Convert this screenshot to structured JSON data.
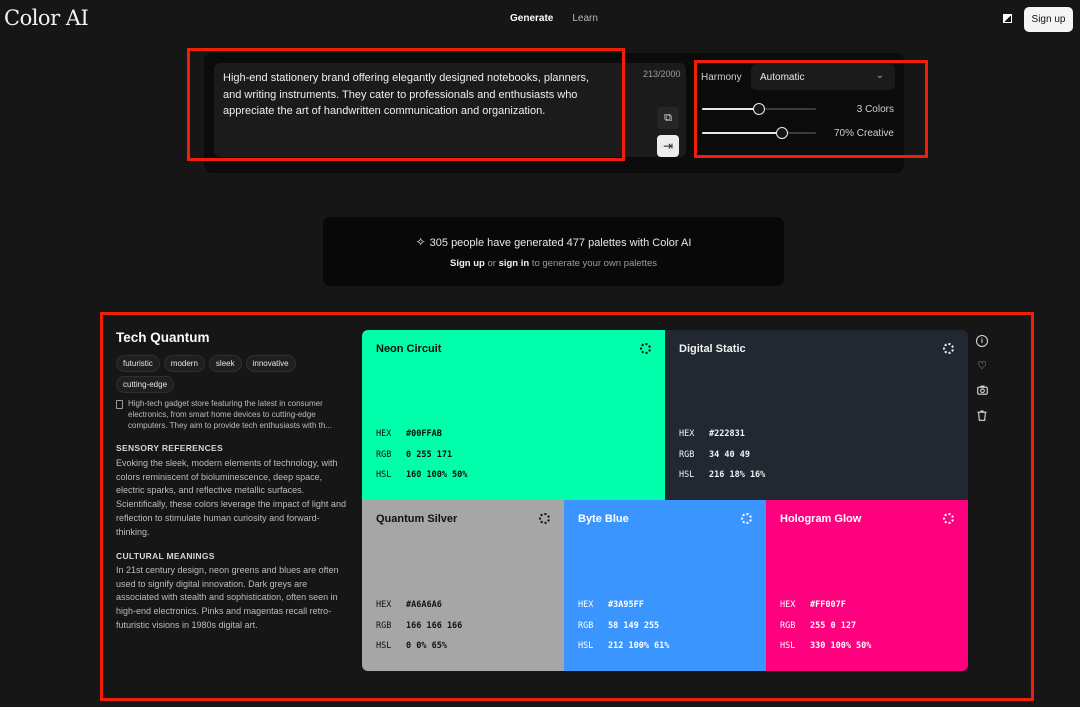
{
  "app": {
    "logo": "Color AI"
  },
  "nav": {
    "generate": "Generate",
    "learn": "Learn"
  },
  "header": {
    "signup": "Sign up"
  },
  "prompt": {
    "text": "High-end stationery brand offering elegantly designed notebooks, planners, and writing instruments. They cater to professionals and enthusiasts who appreciate the art of handwritten communication and organization.",
    "char_count": "213/2000"
  },
  "controls": {
    "harmony_label": "Harmony",
    "harmony_value": "Automatic",
    "colors_label": "3 Colors",
    "colors_fraction": 0.5,
    "creative_label": "70% Creative",
    "creative_fraction": 0.7
  },
  "stats": {
    "text": "305 people have generated 477 palettes with Color AI",
    "signup_link": "Sign up",
    "or": " or ",
    "signin_link": "sign in",
    "suffix": " to generate your own palettes"
  },
  "palette": {
    "title": "Tech Quantum",
    "tags": [
      "futuristic",
      "modern",
      "sleek",
      "innovative",
      "cutting-edge"
    ],
    "description": "High-tech gadget store featuring the latest in consumer electronics, from smart home devices to cutting-edge computers. They aim to provide tech enthusiasts with th...",
    "sensory_heading": "SENSORY REFERENCES",
    "sensory_text": "Evoking the sleek, modern elements of technology, with colors reminiscent of bioluminescence, deep space, electric sparks, and reflective metallic surfaces. Scientifically, these colors leverage the impact of light and reflection to stimulate human curiosity and forward-thinking.",
    "cultural_heading": "CULTURAL MEANINGS",
    "cultural_text": "In 21st century design, neon greens and blues are often used to signify digital innovation. Dark greys are associated with stealth and sophistication, often seen in high-end electronics. Pinks and magentas recall retro-futuristic visions in 1980s digital art.",
    "colors": [
      {
        "name": "Neon Circuit",
        "hex_label": "HEX",
        "hex": "#00FFAB",
        "rgb_label": "RGB",
        "rgb": "0 255 171",
        "hsl_label": "HSL",
        "hsl": "160 100% 50%",
        "color": "#00FFAB",
        "text_color": "#0b0b0b"
      },
      {
        "name": "Digital Static",
        "hex_label": "HEX",
        "hex": "#222831",
        "rgb_label": "RGB",
        "rgb": "34 40 49",
        "hsl_label": "HSL",
        "hsl": "216 18% 16%",
        "color": "#222831",
        "text_color": "#f2f2f2"
      },
      {
        "name": "Quantum Silver",
        "hex_label": "HEX",
        "hex": "#A6A6A6",
        "rgb_label": "RGB",
        "rgb": "166 166 166",
        "hsl_label": "HSL",
        "hsl": "0 0% 65%",
        "color": "#A6A6A6",
        "text_color": "#111111"
      },
      {
        "name": "Byte Blue",
        "hex_label": "HEX",
        "hex": "#3A95FF",
        "rgb_label": "RGB",
        "rgb": "58 149 255",
        "hsl_label": "HSL",
        "hsl": "212 100% 61%",
        "color": "#3A95FF",
        "text_color": "#ffffff"
      },
      {
        "name": "Hologram Glow",
        "hex_label": "HEX",
        "hex": "#FF007F",
        "rgb_label": "RGB",
        "rgb": "255 0 127",
        "hsl_label": "HSL",
        "hsl": "330 100% 50%",
        "color": "#FF007F",
        "text_color": "#ffffff"
      }
    ]
  },
  "side_actions": {
    "info_icon": "info-icon",
    "heart_icon": "heart-icon",
    "camera_icon": "camera-icon",
    "trash_icon": "trash-icon"
  },
  "annotation_color": "#F01E0A"
}
